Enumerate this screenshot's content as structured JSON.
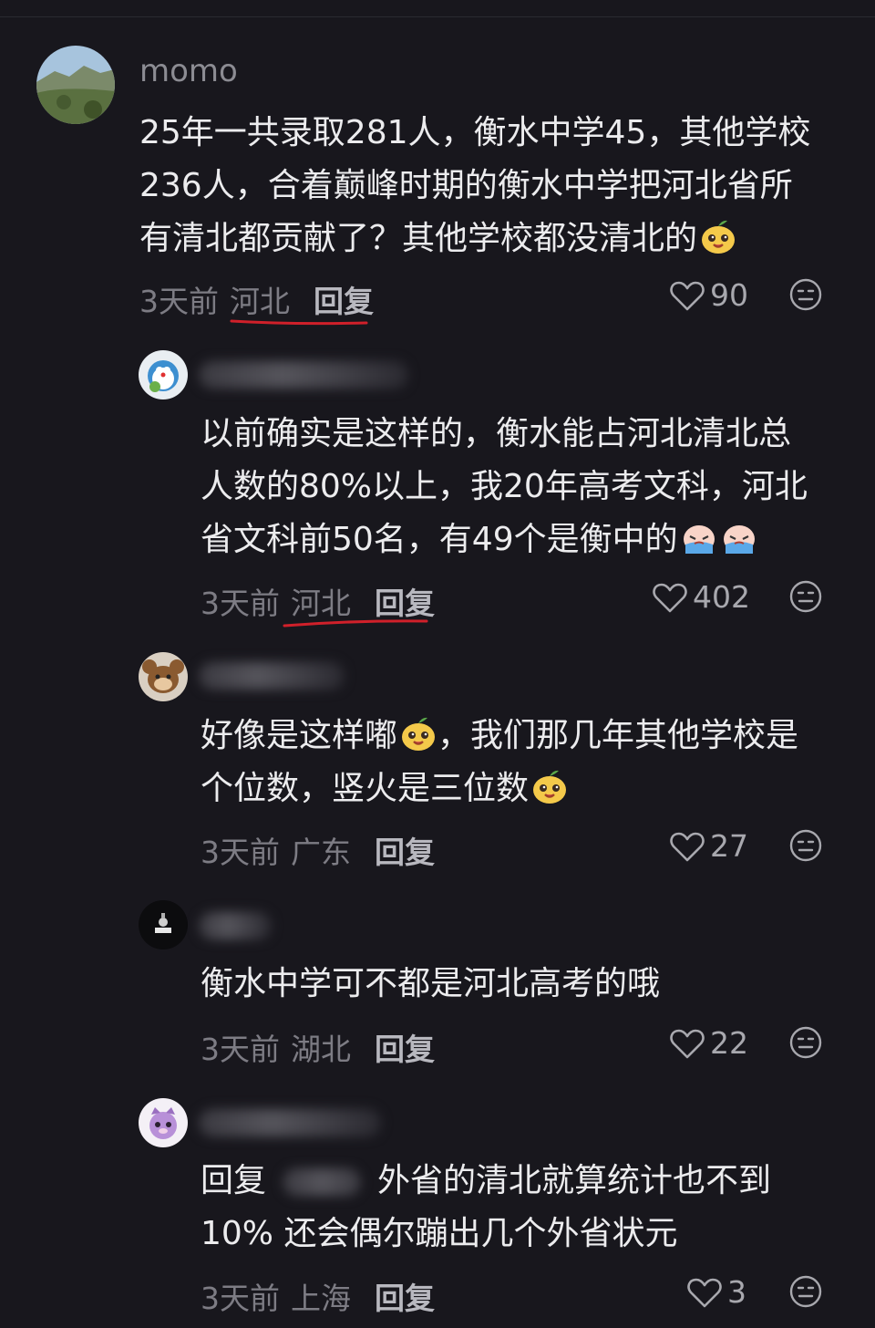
{
  "comments": [
    {
      "username": "momo",
      "text": "25年一共录取281人，衡水中学45，其他学校\n236人，合着巅峰时期的衡水中学把河北省所\n有清北都贡献了？其他学校都没清北的",
      "time": "3天前",
      "location": "河北",
      "reply_label": "回复",
      "likes": "90"
    },
    {
      "username": "",
      "text": "以前确实是这样的，衡水能占河北清北总\n人数的80%以上，我20年高考文科，河北\n省文科前50名，有49个是衡中的",
      "time": "3天前",
      "location": "河北",
      "reply_label": "回复",
      "likes": "402"
    },
    {
      "username": "",
      "text": "好像是这样嘟",
      "text_b": "，我们那几年其他学校是\n个位数，竖火是三位数",
      "time": "3天前",
      "location": "广东",
      "reply_label": "回复",
      "likes": "27"
    },
    {
      "username": "",
      "text": "衡水中学可不都是河北高考的哦",
      "time": "3天前",
      "location": "湖北",
      "reply_label": "回复",
      "likes": "22"
    },
    {
      "username": "",
      "reply_prefix": "回复",
      "text": "外省的清北就算统计也不到",
      "text_b": "10% 还会偶尔蹦出几个外省状元",
      "time": "3天前",
      "location": "上海",
      "reply_label": "回复",
      "likes": "3"
    }
  ],
  "colors": {
    "background": "#18171d",
    "text": "#ececee",
    "meta": "#7d7c84",
    "underline": "#d0202a"
  },
  "icons": {
    "like": "heart-outline-icon",
    "dislike": "meh-face-icon",
    "emoji": "smiling-fruit-emoji"
  }
}
